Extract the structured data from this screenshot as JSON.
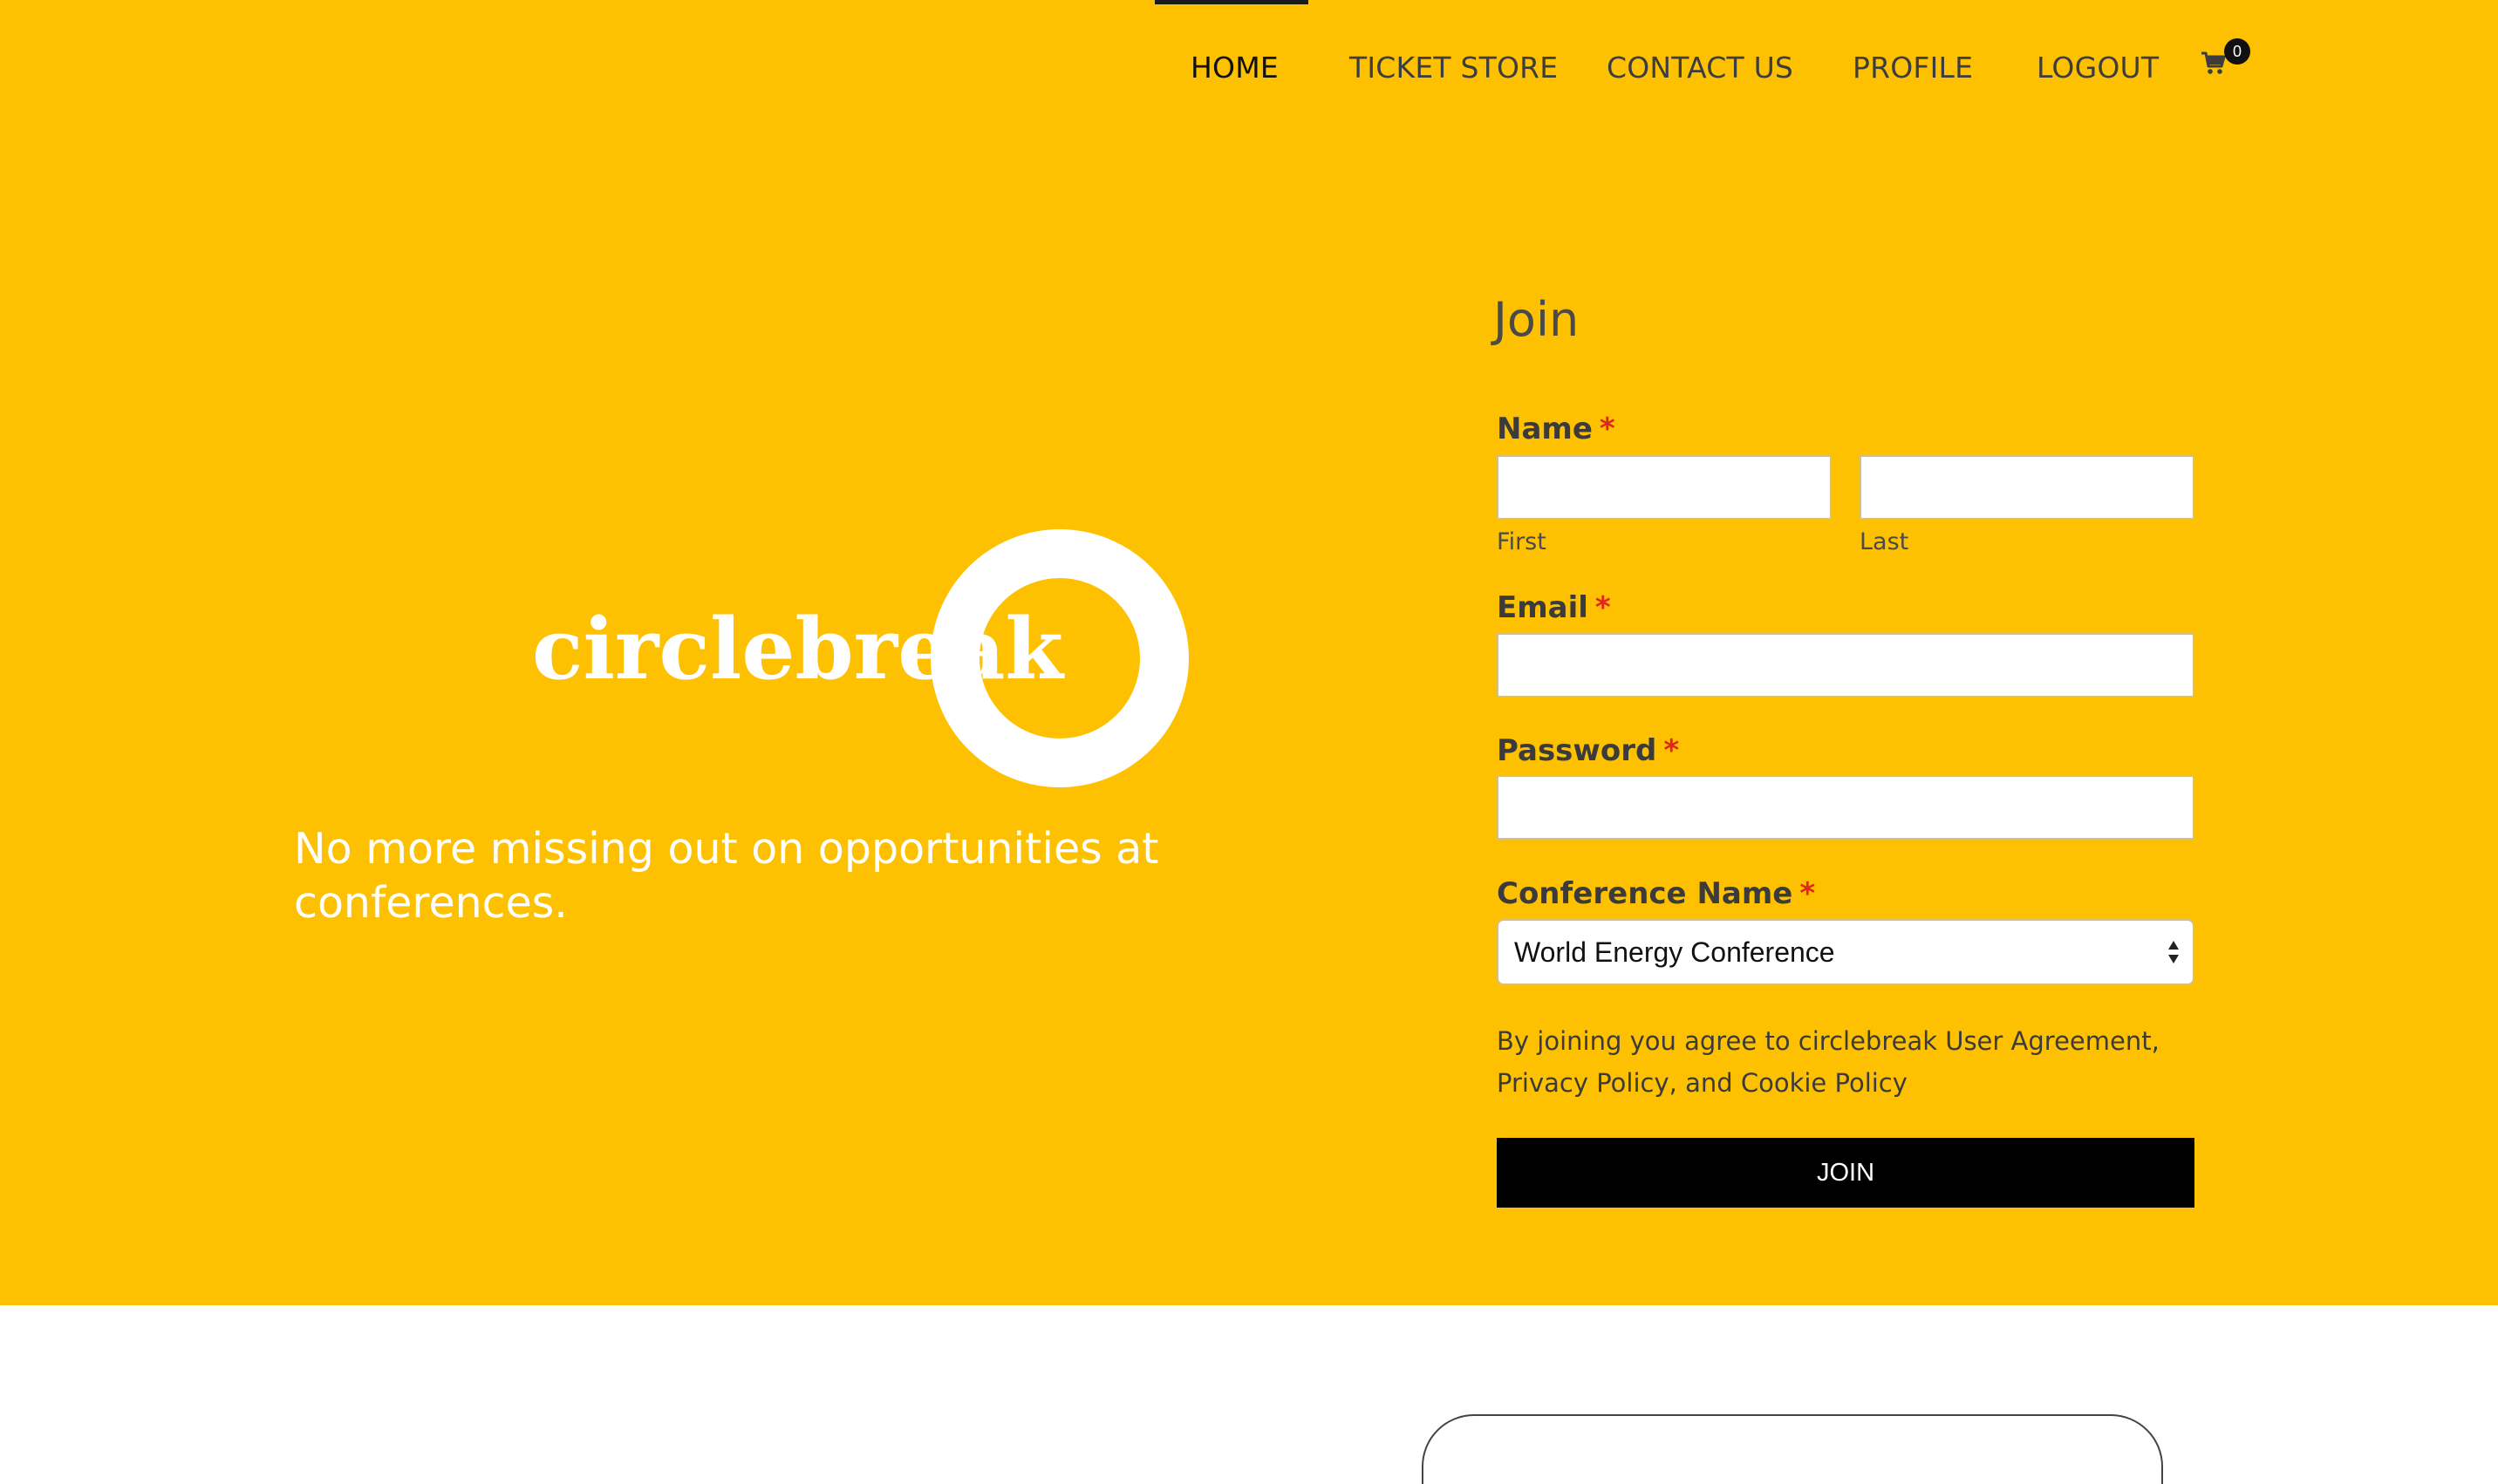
{
  "nav": {
    "items": [
      {
        "label": "HOME",
        "active": true
      },
      {
        "label": "TICKET STORE",
        "active": false
      },
      {
        "label": "CONTACT US",
        "active": false
      },
      {
        "label": "PROFILE",
        "active": false
      },
      {
        "label": "LOGOUT",
        "active": false
      }
    ],
    "cart": {
      "icon": "cart-icon",
      "count": "0"
    }
  },
  "brand": {
    "logo_text": "circlebreak",
    "tagline": "No more missing out on opportunities at conferences."
  },
  "form": {
    "title": "Join",
    "name_label": "Name",
    "required_mark": "*",
    "first_sublabel": "First",
    "last_sublabel": "Last",
    "first_value": "",
    "last_value": "",
    "email_label": "Email",
    "email_value": "",
    "password_label": "Password",
    "password_value": "",
    "conference_label": "Conference Name",
    "conference_selected": "World Energy Conference",
    "terms": "By joining you agree to circlebreak User Agreement, Privacy Policy, and Cookie Policy",
    "submit_label": "JOIN"
  },
  "colors": {
    "hero_bg": "#fec101",
    "button_bg": "#000000",
    "required": "#e0261b"
  }
}
